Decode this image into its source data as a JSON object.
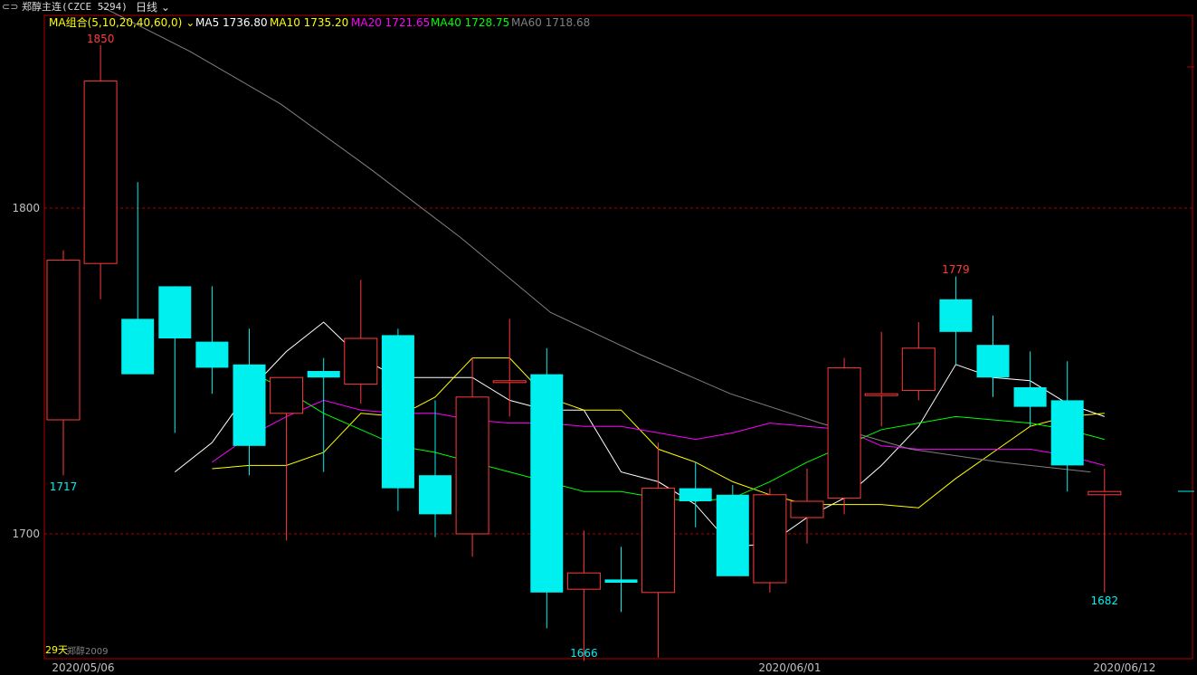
{
  "header": {
    "symbol_label": "郑醇主连(CZCE 5294)",
    "period_label": "日线",
    "period_menu_icon": "chevron-down-icon",
    "symbol_icon": "link-icon"
  },
  "indicators": {
    "group_label": "MA组合(5,10,20,40,60,0)",
    "group_dropdown_icon": "chevron-down-icon",
    "items": [
      {
        "label": "MA5 1736.80",
        "color": "#ffffff"
      },
      {
        "label": "MA10 1735.20",
        "color": "#ffff00"
      },
      {
        "label": "MA20 1721.65",
        "color": "#ff00ff"
      },
      {
        "label": "MA40 1728.75",
        "color": "#00ff00"
      },
      {
        "label": "MA60 1718.68",
        "color": "#808080"
      }
    ]
  },
  "colors": {
    "up": "#ff3b3b",
    "down": "#00f0f0",
    "grid": "#b00000",
    "axis_text": "#c0c0c0",
    "ma5": "#ffffff",
    "ma10": "#ffff00",
    "ma20": "#ff00ff",
    "ma40": "#00ff00",
    "ma60": "#808080"
  },
  "footer": {
    "days_label": "29天",
    "watermark": "郑醇2009"
  },
  "chart_data": {
    "type": "candlestick",
    "ylim": [
      1662,
      1865
    ],
    "y_ticks": [
      1700,
      1800
    ],
    "x_tick_labels": [
      "2020/05/06",
      "2020/06/01",
      "2020/06/12"
    ],
    "x_tick_index": [
      0,
      19,
      28
    ],
    "high_label": "1850",
    "low_label": "1666",
    "local_high_label": "1779",
    "last_low_label": "1682",
    "first_low_label": "1717",
    "candles": [
      {
        "o": 1735,
        "h": 1787,
        "l": 1718,
        "c": 1784
      },
      {
        "o": 1783,
        "h": 1850,
        "l": 1772,
        "c": 1839
      },
      {
        "o": 1766,
        "h": 1808,
        "l": 1751,
        "c": 1749
      },
      {
        "o": 1776,
        "h": 1776,
        "l": 1731,
        "c": 1760
      },
      {
        "o": 1759,
        "h": 1776,
        "l": 1743,
        "c": 1751
      },
      {
        "o": 1752,
        "h": 1763,
        "l": 1718,
        "c": 1727
      },
      {
        "o": 1737,
        "h": 1748,
        "l": 1698,
        "c": 1748
      },
      {
        "o": 1750,
        "h": 1754,
        "l": 1719,
        "c": 1748
      },
      {
        "o": 1746,
        "h": 1778,
        "l": 1740,
        "c": 1760
      },
      {
        "o": 1761,
        "h": 1763,
        "l": 1707,
        "c": 1714
      },
      {
        "o": 1718,
        "h": 1741,
        "l": 1699,
        "c": 1706
      },
      {
        "o": 1700,
        "h": 1754,
        "l": 1693,
        "c": 1742
      },
      {
        "o": 1747,
        "h": 1766,
        "l": 1736,
        "c": 1747
      },
      {
        "o": 1749,
        "h": 1757,
        "l": 1671,
        "c": 1682
      },
      {
        "o": 1683,
        "h": 1701,
        "l": 1661,
        "c": 1688
      },
      {
        "o": 1686,
        "h": 1696,
        "l": 1676,
        "c": 1685
      },
      {
        "o": 1682,
        "h": 1728,
        "l": 1662,
        "c": 1714
      },
      {
        "o": 1714,
        "h": 1722,
        "l": 1702,
        "c": 1710
      },
      {
        "o": 1712,
        "h": 1715,
        "l": 1689,
        "c": 1687
      },
      {
        "o": 1685,
        "h": 1714,
        "l": 1682,
        "c": 1712
      },
      {
        "o": 1705,
        "h": 1720,
        "l": 1697,
        "c": 1710
      },
      {
        "o": 1711,
        "h": 1754,
        "l": 1706,
        "c": 1751
      },
      {
        "o": 1743,
        "h": 1762,
        "l": 1733,
        "c": 1743
      },
      {
        "o": 1744,
        "h": 1765,
        "l": 1741,
        "c": 1757
      },
      {
        "o": 1772,
        "h": 1779,
        "l": 1752,
        "c": 1762
      },
      {
        "o": 1758,
        "h": 1767,
        "l": 1742,
        "c": 1748
      },
      {
        "o": 1745,
        "h": 1756,
        "l": 1733,
        "c": 1739
      },
      {
        "o": 1741,
        "h": 1753,
        "l": 1713,
        "c": 1721
      },
      {
        "o": 1712,
        "h": 1720,
        "l": 1682,
        "c": 1713
      }
    ],
    "series": [
      {
        "name": "MA5",
        "values": [
          1719,
          1728,
          1744,
          1756,
          1765,
          1754,
          1748,
          1748,
          1748,
          1741,
          1738,
          1738,
          1719,
          1716,
          1709,
          1696,
          1697,
          1705,
          1711,
          1721,
          1733,
          1752,
          1748,
          1747,
          1740,
          1736
        ]
      },
      {
        "name": "MA10",
        "values": [
          1720,
          1721,
          1721,
          1725,
          1737,
          1736,
          1742,
          1754,
          1754,
          1742,
          1738,
          1738,
          1726,
          1722,
          1716,
          1712,
          1709,
          1709,
          1709,
          1708,
          1717,
          1725,
          1733,
          1736,
          1737
        ]
      },
      {
        "name": "MA20",
        "values": [
          1722,
          1730,
          1736,
          1741,
          1738,
          1737,
          1737,
          1735,
          1734,
          1734,
          1733,
          1733,
          1731,
          1729,
          1731,
          1734,
          1733,
          1732,
          1727,
          1726,
          1726,
          1726,
          1726,
          1724,
          1721
        ]
      },
      {
        "name": "MA40",
        "values": [
          1750,
          1744,
          1737,
          1732,
          1727,
          1725,
          1722,
          1719,
          1716,
          1713,
          1713,
          1711,
          1710,
          1711,
          1716,
          1722,
          1727,
          1732,
          1734,
          1736,
          1735,
          1734,
          1732,
          1729
        ]
      },
      {
        "name": "MA60",
        "values": [
          1862,
          1848,
          1832,
          1812,
          1791,
          1768,
          1755,
          1743,
          1734,
          1726,
          1722,
          1719
        ]
      }
    ]
  }
}
